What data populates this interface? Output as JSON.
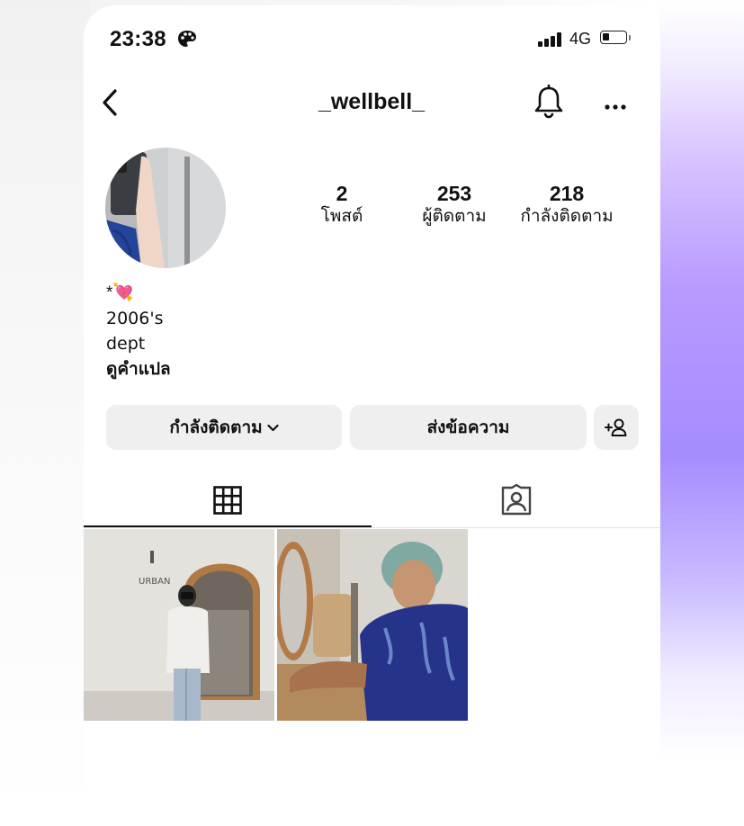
{
  "status_bar": {
    "time": "23:38",
    "network": "4G",
    "battery_level": 0.3
  },
  "nav": {
    "username": "_wellbell_"
  },
  "stats": [
    {
      "value": "2",
      "label": "โพสต์"
    },
    {
      "value": "253",
      "label": "ผู้ติดตาม"
    },
    {
      "value": "218",
      "label": "กำลังติดตาม"
    }
  ],
  "bio": {
    "line1": "*💘",
    "line2": "2006's",
    "line3": "dept",
    "translate": "ดูคำแปล"
  },
  "actions": {
    "following": "กำลังติดตาม",
    "message": "ส่งข้อความ"
  },
  "photos": [
    {
      "sign_text": "URBAN"
    },
    {
      "sign_text": ""
    }
  ],
  "icons": [
    "palette-icon",
    "signal-icon",
    "battery-icon",
    "back-arrow-icon",
    "bell-icon",
    "more-icon",
    "chevron-down-icon",
    "add-person-icon",
    "grid-icon",
    "tagged-icon"
  ]
}
